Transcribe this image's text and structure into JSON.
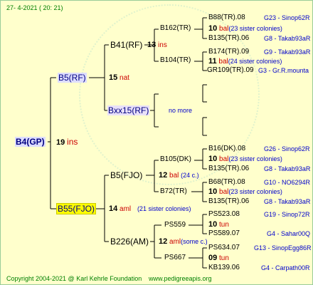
{
  "header": {
    "date": "27-  4-2021 ( 20: 21)"
  },
  "footer": {
    "copyright": "Copyright 2004-2021 @ Karl Kehrle Foundation",
    "url": "www.pedigreeapis.org"
  },
  "root": {
    "id": "B4(GP)",
    "num": "19",
    "tag": "ins"
  },
  "f1": {
    "id": "B5(RF)",
    "num": "15",
    "tag": "nat"
  },
  "f11": {
    "id": "B41(RF)",
    "num": "13",
    "tag": "ins"
  },
  "f111": {
    "id": "B162(TR)",
    "num": "10",
    "tag": "bal",
    "note": "(23 sister colonies)"
  },
  "f112": {
    "id": "B104(TR)",
    "num": "11",
    "tag": "bal",
    "note": "(24 sister colonies)"
  },
  "f12": {
    "id": "Bxx15(RF)",
    "note": "no more"
  },
  "m1": {
    "id": "B55(FJO)",
    "num": "14",
    "tag": "aml",
    "note": "(21 sister colonies)"
  },
  "m11": {
    "id": "B5(FJO)",
    "num": "12",
    "tag": "bal",
    "note": "(24 c.)"
  },
  "m111": {
    "id": "B105(DK)",
    "num": "10",
    "tag": "bal",
    "note": "(23 sister colonies)"
  },
  "m112": {
    "id": "B72(TR)",
    "num": "10",
    "tag": "bal",
    "note": "(23 sister colonies)"
  },
  "m12": {
    "id": "B226(AM)",
    "num": "12",
    "tag": "aml",
    "note": "(some c.)"
  },
  "m121": {
    "id": "PS559",
    "num": "10",
    "tag": "tun"
  },
  "m122": {
    "id": "PS667",
    "num": "09",
    "tag": "tun"
  },
  "ancestors": [
    {
      "id": "B88(TR).08",
      "ref": "G23 - Sinop62R"
    },
    {
      "id": "B135(TR).06",
      "ref": "G8 - Takab93aR"
    },
    {
      "id": "B174(TR).09",
      "ref": "G9 - Takab93aR"
    },
    {
      "id": "GR109(TR).09",
      "ref": "G3 - Gr.R.mounta"
    },
    {
      "id": "B16(DK).08",
      "ref": "G26 - Sinop62R"
    },
    {
      "id": "B135(TR).06",
      "ref": "G8 - Takab93aR"
    },
    {
      "id": "B68(TR).08",
      "ref": "G10 - NO6294R"
    },
    {
      "id": "B135(TR).06",
      "ref": "G8 - Takab93aR"
    },
    {
      "id": "PS523.08",
      "ref": "G19 - Sinop72R"
    },
    {
      "id": "PS589.07",
      "ref": "G4 - Sahar00Q"
    },
    {
      "id": "PS634.07",
      "ref": "G13 - SinopEgg86R"
    },
    {
      "id": "KB139.06",
      "ref": "G4 - Carpath00R"
    }
  ],
  "colors": {
    "background": "#ffffcc",
    "lines": "#000000",
    "ref_blue": "#0000cc",
    "tag_red": "#cc0000",
    "header_green": "#008000",
    "highlight_yellow": "#ffff00"
  }
}
